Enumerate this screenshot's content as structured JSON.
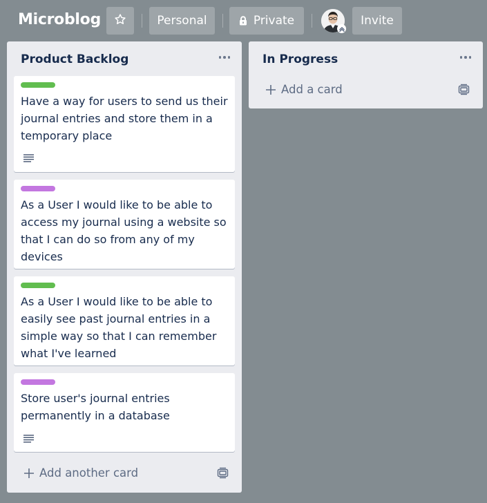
{
  "header": {
    "title": "Microblog",
    "star_icon": "star-icon",
    "personal_label": "Personal",
    "private_label": "Private",
    "private_icon": "lock-icon",
    "avatar_icon": "avatar-photo",
    "invite_label": "Invite"
  },
  "lists": [
    {
      "title": "Product Backlog",
      "menu_icon": "ellipsis-icon",
      "cards": [
        {
          "label_color": "#61bd4f",
          "text": "Have a way for users to send us their journal entries and store them in a temporary place",
          "has_description": true
        },
        {
          "label_color": "#c377e0",
          "text": "As a User I would like to be able to access my journal using a website so that I can do so from any of my devices",
          "has_description": false
        },
        {
          "label_color": "#61bd4f",
          "text": "As a User I would like to be able to easily see past journal entries in a simple way so that I can remember what I've learned",
          "has_description": false
        },
        {
          "label_color": "#c377e0",
          "text": "Store user's journal entries permanently in a database",
          "has_description": true
        }
      ],
      "add_label": "Add another card"
    },
    {
      "title": "In Progress",
      "menu_icon": "ellipsis-icon",
      "cards": [],
      "add_label": "Add a card"
    }
  ],
  "colors": {
    "board_bg": "#838c91",
    "list_bg": "#ebecf0",
    "label_green": "#61bd4f",
    "label_purple": "#c377e0"
  }
}
